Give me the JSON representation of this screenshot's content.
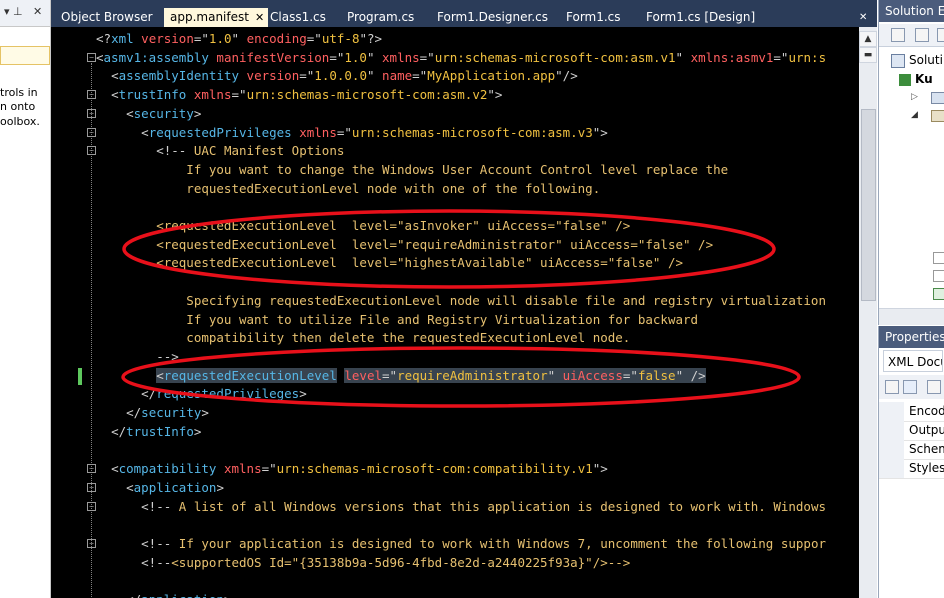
{
  "toolbox": {
    "pin_icon": "pin-icon",
    "close_icon": "close-icon",
    "lines": [
      "trols in",
      "n onto",
      "oolbox."
    ]
  },
  "tabs": [
    {
      "label": "Object Browser",
      "active": false
    },
    {
      "label": "app.manifest",
      "active": true
    },
    {
      "label": "Class1.cs",
      "active": false
    },
    {
      "label": "Program.cs",
      "active": false
    },
    {
      "label": "Form1.Designer.cs",
      "active": false
    },
    {
      "label": "Form1.cs",
      "active": false
    },
    {
      "label": "Form1.cs [Design]",
      "active": false
    }
  ],
  "tab_close_glyph": "✕",
  "editor": {
    "lines": [
      [
        {
          "c": "punct",
          "t": "<?"
        },
        {
          "c": "tag",
          "t": "xml"
        },
        {
          "c": "text",
          "t": " "
        },
        {
          "c": "attr",
          "t": "version"
        },
        {
          "c": "punct",
          "t": "=\""
        },
        {
          "c": "val",
          "t": "1.0"
        },
        {
          "c": "punct",
          "t": "\" "
        },
        {
          "c": "attr",
          "t": "encoding"
        },
        {
          "c": "punct",
          "t": "=\""
        },
        {
          "c": "val",
          "t": "utf-8"
        },
        {
          "c": "punct",
          "t": "\"?>"
        }
      ],
      [
        {
          "c": "punct",
          "t": "<"
        },
        {
          "c": "tag",
          "t": "asmv1:assembly"
        },
        {
          "c": "text",
          "t": " "
        },
        {
          "c": "attr",
          "t": "manifestVersion"
        },
        {
          "c": "punct",
          "t": "=\""
        },
        {
          "c": "val",
          "t": "1.0"
        },
        {
          "c": "punct",
          "t": "\" "
        },
        {
          "c": "attr",
          "t": "xmlns"
        },
        {
          "c": "punct",
          "t": "=\""
        },
        {
          "c": "val",
          "t": "urn:schemas-microsoft-com:asm.v1"
        },
        {
          "c": "punct",
          "t": "\" "
        },
        {
          "c": "attr",
          "t": "xmlns:asmv1"
        },
        {
          "c": "punct",
          "t": "=\""
        },
        {
          "c": "val",
          "t": "urn:s"
        }
      ],
      [
        {
          "c": "text",
          "t": "  "
        },
        {
          "c": "punct",
          "t": "<"
        },
        {
          "c": "tag",
          "t": "assemblyIdentity"
        },
        {
          "c": "text",
          "t": " "
        },
        {
          "c": "attr",
          "t": "version"
        },
        {
          "c": "punct",
          "t": "=\""
        },
        {
          "c": "val",
          "t": "1.0.0.0"
        },
        {
          "c": "punct",
          "t": "\" "
        },
        {
          "c": "attr",
          "t": "name"
        },
        {
          "c": "punct",
          "t": "=\""
        },
        {
          "c": "val",
          "t": "MyApplication.app"
        },
        {
          "c": "punct",
          "t": "\"/>"
        }
      ],
      [
        {
          "c": "text",
          "t": "  "
        },
        {
          "c": "punct",
          "t": "<"
        },
        {
          "c": "tag",
          "t": "trustInfo"
        },
        {
          "c": "text",
          "t": " "
        },
        {
          "c": "attr",
          "t": "xmlns"
        },
        {
          "c": "punct",
          "t": "=\""
        },
        {
          "c": "val",
          "t": "urn:schemas-microsoft-com:asm.v2"
        },
        {
          "c": "punct",
          "t": "\">"
        }
      ],
      [
        {
          "c": "text",
          "t": "    "
        },
        {
          "c": "punct",
          "t": "<"
        },
        {
          "c": "tag",
          "t": "security"
        },
        {
          "c": "punct",
          "t": ">"
        }
      ],
      [
        {
          "c": "text",
          "t": "      "
        },
        {
          "c": "punct",
          "t": "<"
        },
        {
          "c": "tag",
          "t": "requestedPrivileges"
        },
        {
          "c": "text",
          "t": " "
        },
        {
          "c": "attr",
          "t": "xmlns"
        },
        {
          "c": "punct",
          "t": "=\""
        },
        {
          "c": "val",
          "t": "urn:schemas-microsoft-com:asm.v3"
        },
        {
          "c": "punct",
          "t": "\">"
        }
      ],
      [
        {
          "c": "text",
          "t": "        "
        },
        {
          "c": "punct",
          "t": "<!--"
        },
        {
          "c": "comment",
          "t": " UAC Manifest Options"
        }
      ],
      [
        {
          "c": "comment",
          "t": "            If you want to change the Windows User Account Control level replace the"
        }
      ],
      [
        {
          "c": "comment",
          "t": "            requestedExecutionLevel node with one of the following."
        }
      ],
      [
        {
          "c": "comment",
          "t": ""
        }
      ],
      [
        {
          "c": "comment",
          "t": "        <requestedExecutionLevel  level=\"asInvoker\" uiAccess=\"false\" />"
        }
      ],
      [
        {
          "c": "comment",
          "t": "        <requestedExecutionLevel  level=\"requireAdministrator\" uiAccess=\"false\" />"
        }
      ],
      [
        {
          "c": "comment",
          "t": "        <requestedExecutionLevel  level=\"highestAvailable\" uiAccess=\"false\" />"
        }
      ],
      [
        {
          "c": "comment",
          "t": ""
        }
      ],
      [
        {
          "c": "comment",
          "t": "            Specifying requestedExecutionLevel node will disable file and registry virtualization"
        }
      ],
      [
        {
          "c": "comment",
          "t": "            If you want to utilize File and Registry Virtualization for backward"
        }
      ],
      [
        {
          "c": "comment",
          "t": "            compatibility then delete the requestedExecutionLevel node."
        }
      ],
      [
        {
          "c": "text",
          "t": "        "
        },
        {
          "c": "punct",
          "t": "-->"
        }
      ],
      [
        {
          "c": "text",
          "t": "        "
        },
        {
          "c": "punct",
          "t": "<"
        },
        {
          "c": "tag",
          "t": "requestedExecutionLevel"
        },
        {
          "c": "text",
          "t": " "
        },
        {
          "c": "attr",
          "t": "level"
        },
        {
          "c": "punct",
          "t": "=\""
        },
        {
          "c": "val",
          "t": "requireAdministrator"
        },
        {
          "c": "punct",
          "t": "\" "
        },
        {
          "c": "attr",
          "t": "uiAccess"
        },
        {
          "c": "punct",
          "t": "=\""
        },
        {
          "c": "val",
          "t": "false"
        },
        {
          "c": "punct",
          "t": "\" />"
        }
      ],
      [
        {
          "c": "text",
          "t": "      "
        },
        {
          "c": "punct",
          "t": "</"
        },
        {
          "c": "tag",
          "t": "requestedPrivileges"
        },
        {
          "c": "punct",
          "t": ">"
        }
      ],
      [
        {
          "c": "text",
          "t": "    "
        },
        {
          "c": "punct",
          "t": "</"
        },
        {
          "c": "tag",
          "t": "security"
        },
        {
          "c": "punct",
          "t": ">"
        }
      ],
      [
        {
          "c": "text",
          "t": "  "
        },
        {
          "c": "punct",
          "t": "</"
        },
        {
          "c": "tag",
          "t": "trustInfo"
        },
        {
          "c": "punct",
          "t": ">"
        }
      ],
      [
        {
          "c": "text",
          "t": ""
        }
      ],
      [
        {
          "c": "text",
          "t": "  "
        },
        {
          "c": "punct",
          "t": "<"
        },
        {
          "c": "tag",
          "t": "compatibility"
        },
        {
          "c": "text",
          "t": " "
        },
        {
          "c": "attr",
          "t": "xmlns"
        },
        {
          "c": "punct",
          "t": "=\""
        },
        {
          "c": "val",
          "t": "urn:schemas-microsoft-com:compatibility.v1"
        },
        {
          "c": "punct",
          "t": "\">"
        }
      ],
      [
        {
          "c": "text",
          "t": "    "
        },
        {
          "c": "punct",
          "t": "<"
        },
        {
          "c": "tag",
          "t": "application"
        },
        {
          "c": "punct",
          "t": ">"
        }
      ],
      [
        {
          "c": "text",
          "t": "      "
        },
        {
          "c": "punct",
          "t": "<!--"
        },
        {
          "c": "comment",
          "t": " A list of all Windows versions that this application is designed to work with. Windows"
        }
      ],
      [
        {
          "c": "text",
          "t": ""
        }
      ],
      [
        {
          "c": "text",
          "t": "      "
        },
        {
          "c": "punct",
          "t": "<!--"
        },
        {
          "c": "comment",
          "t": " If your application is designed to work with Windows 7, uncomment the following suppor"
        }
      ],
      [
        {
          "c": "text",
          "t": "      "
        },
        {
          "c": "punct",
          "t": "<!--"
        },
        {
          "c": "comment",
          "t": "<supportedOS Id=\"{35138b9a-5d96-4fbd-8e2d-a2440225f93a}\"/>-->"
        }
      ],
      [
        {
          "c": "text",
          "t": ""
        }
      ],
      [
        {
          "c": "text",
          "t": "    "
        },
        {
          "c": "punct",
          "t": "</"
        },
        {
          "c": "tag",
          "t": "application"
        },
        {
          "c": "punct",
          "t": ">"
        }
      ]
    ],
    "highlighted_line": 18
  },
  "solution_explorer": {
    "title": "Solution Exp",
    "items": [
      "Soluti",
      "Ku"
    ]
  },
  "properties": {
    "title": "Properties",
    "object": "XML Docu",
    "rows": [
      "Encodi",
      "Output",
      "Schem",
      "Stylesh"
    ]
  },
  "colors": {
    "ellipse": "#e8101a",
    "tab_bar": "#2b3c59",
    "active_tab": "#fff8dc"
  }
}
